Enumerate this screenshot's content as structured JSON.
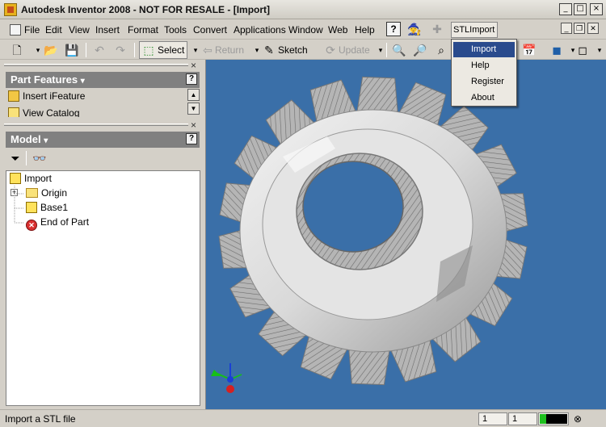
{
  "window": {
    "title": "Autodesk Inventor 2008 - NOT FOR RESALE - [Import]",
    "minimize": "_",
    "maximize": "□",
    "close": "×"
  },
  "menu": {
    "items": [
      "File",
      "Edit",
      "View",
      "Insert",
      "Format",
      "Tools",
      "Convert",
      "Applications",
      "Window",
      "Web",
      "Help"
    ],
    "help_button": "?",
    "stl_import": "STLImport"
  },
  "toolbar": {
    "select": "Select",
    "return": "Return",
    "sketch": "Sketch",
    "update": "Update"
  },
  "stl_menu": {
    "items": [
      "Import",
      "Help",
      "Register",
      "About"
    ],
    "selected": "Import"
  },
  "part_features": {
    "title": "Part Features",
    "help": "?",
    "items": [
      "Insert iFeature",
      "View Catalog"
    ]
  },
  "model_panel": {
    "title": "Model",
    "help": "?",
    "tree": {
      "root": "Import",
      "origin": "Origin",
      "base": "Base1",
      "end": "End of Part"
    }
  },
  "status": {
    "text": "Import a STL file",
    "box1": "1",
    "box2": "1"
  },
  "colors": {
    "viewport": "#3a6fa8",
    "menu_highlight": "#2a4b8d",
    "panel_header": "#808080"
  }
}
